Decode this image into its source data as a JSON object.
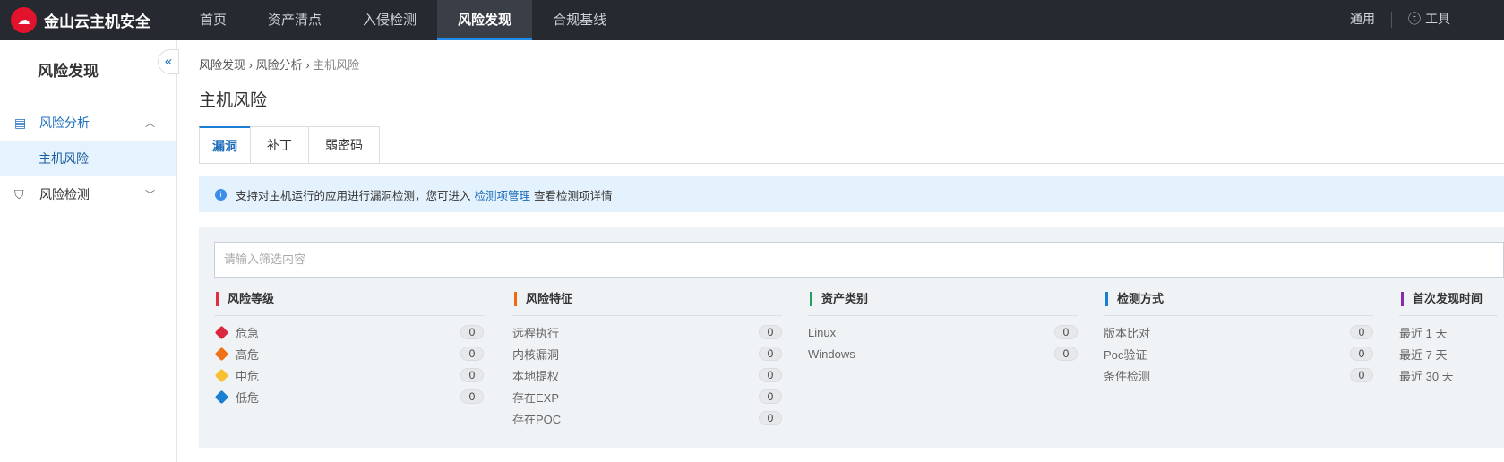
{
  "app": {
    "title": "金山云主机安全"
  },
  "nav": [
    "首页",
    "资产清点",
    "入侵检测",
    "风险发现",
    "合规基线"
  ],
  "topright": {
    "general": "通用",
    "tools": "工具"
  },
  "sidebar": {
    "title": "风险发现",
    "items": [
      {
        "label": "风险分析"
      },
      {
        "label": "主机风险"
      },
      {
        "label": "风险检测"
      }
    ]
  },
  "breadcrumb": [
    "风险发现",
    "风险分析",
    "主机风险"
  ],
  "page_title": "主机风险",
  "tabs": [
    "漏洞",
    "补丁",
    "弱密码"
  ],
  "info": {
    "pre": "支持对主机运行的应用进行漏洞检测，您可进入",
    "link": "检测项管理",
    "post": "查看检测项详情"
  },
  "search": {
    "placeholder": "请输入筛选内容"
  },
  "filters": [
    {
      "title": "风险等级",
      "color": "#e0303f",
      "items": [
        {
          "label": "危急",
          "count": "0",
          "color": "#d9283f"
        },
        {
          "label": "高危",
          "count": "0",
          "color": "#f07015"
        },
        {
          "label": "中危",
          "count": "0",
          "color": "#f8c030"
        },
        {
          "label": "低危",
          "count": "0",
          "color": "#1a7fd2"
        }
      ]
    },
    {
      "title": "风险特征",
      "color": "#ef6a10",
      "items": [
        {
          "label": "远程执行",
          "count": "0"
        },
        {
          "label": "内核漏洞",
          "count": "0"
        },
        {
          "label": "本地提权",
          "count": "0"
        },
        {
          "label": "存在EXP",
          "count": "0"
        },
        {
          "label": "存在POC",
          "count": "0"
        }
      ]
    },
    {
      "title": "资产类别",
      "color": "#20a060",
      "items": [
        {
          "label": "Linux",
          "count": "0"
        },
        {
          "label": "Windows",
          "count": "0"
        }
      ]
    },
    {
      "title": "检测方式",
      "color": "#1a7fd2",
      "items": [
        {
          "label": "版本比对",
          "count": "0"
        },
        {
          "label": "Poc验证",
          "count": "0"
        },
        {
          "label": "条件检测",
          "count": "0"
        }
      ]
    },
    {
      "title": "首次发现时间",
      "color": "#8a2aa8",
      "items": [
        {
          "label": "最近 1 天"
        },
        {
          "label": "最近 7 天"
        },
        {
          "label": "最近 30 天"
        }
      ]
    }
  ]
}
